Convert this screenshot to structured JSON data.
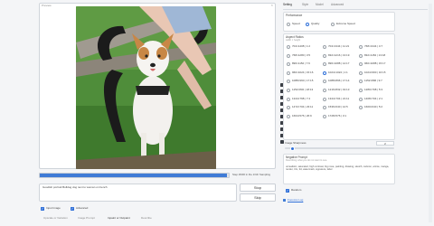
{
  "preview": {
    "label": "Preview",
    "close_glyph": "×"
  },
  "progress": {
    "fraction": 0.99,
    "text": "Step 29/30 in the 1/1th Sampling"
  },
  "prompt": {
    "value": "Goodish portrait Bulldog dog next to woman on bench"
  },
  "buttons": {
    "stop": "Stop",
    "skip": "Skip"
  },
  "options": {
    "input_image": {
      "label": "Input Image",
      "checked": true
    },
    "advanced": {
      "label": "Advanced",
      "checked": true
    }
  },
  "bottom_tabs": [
    "Upscale or Variation",
    "Image Prompt",
    "Inpaint or Outpaint",
    "Describe"
  ],
  "bottom_tab_active": 2,
  "settings_tabs": [
    "Setting",
    "Style",
    "Model",
    "Advanced"
  ],
  "settings_tab_active": 0,
  "performance": {
    "title": "Performance",
    "options": [
      "Speed",
      "Quality",
      "Extreme Speed"
    ],
    "selected": "Quality"
  },
  "aspect_ratios": {
    "title": "Aspect Ratios",
    "subtitle": "width × height",
    "options": [
      "704×1408 | 1:2",
      "704×1344 | 11:21",
      "768×1344 | 4:7",
      "768×1280 | 3:5",
      "832×1216 | 13:19",
      "832×1152 | 13:18",
      "896×1152 | 7:9",
      "896×1088 | 14:17",
      "960×1088 | 15:17",
      "960×1024 | 15:16",
      "1024×1024 | 1:1",
      "1024×960 | 16:15",
      "1088×960 | 17:15",
      "1088×896 | 17:14",
      "1152×896 | 9:7",
      "1152×832 | 18:13",
      "1216×832 | 19:13",
      "1280×768 | 5:3",
      "1344×768 | 7:4",
      "1344×704 | 21:11",
      "1408×704 | 2:1",
      "1472×704 | 23:11",
      "1536×640 | 12:5",
      "1600×640 | 5:2",
      "1664×576 | 26:9",
      "1728×576 | 3:1"
    ],
    "selected": "1024×1024 | 1:1"
  },
  "sharpness": {
    "label": "Image Sharpness",
    "value": "2",
    "fraction": 0.07
  },
  "negative": {
    "title": "Negative Prompt",
    "subtitle": "Describing what you do not want to see.",
    "value": "unrealistic, saturated, high contrast, big nose, painting, drawing, sketch, cartoon, anime, manga, render, CG, 3d, watermark, signature, label"
  },
  "random": {
    "label": "Random",
    "checked": true
  },
  "link": {
    "text": "Fooocus Log"
  },
  "colors": {
    "accent": "#2f6fd8",
    "progress": "#3f7bd6",
    "rail": "#3b3f46"
  },
  "icons": [
    "image-icon",
    "brush-icon",
    "search-icon",
    "gear-icon",
    "link-icon",
    "camera-icon",
    "list-icon",
    "text-icon",
    "star-icon",
    "copy-icon"
  ]
}
